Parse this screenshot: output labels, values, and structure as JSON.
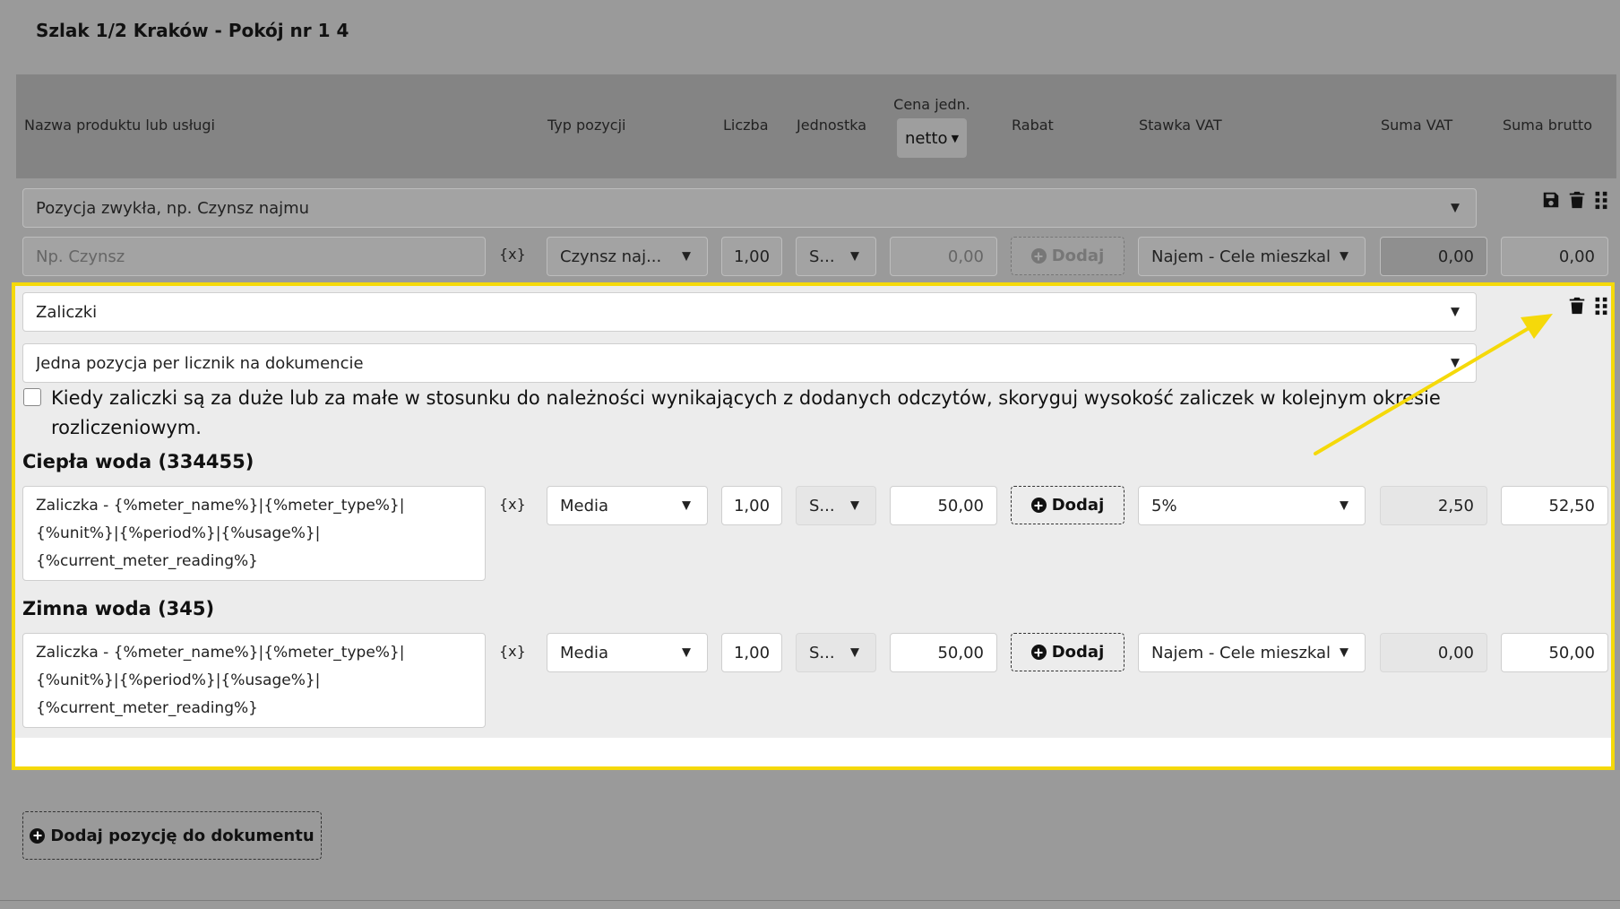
{
  "page": {
    "title": "Szlak 1/2 Kraków - Pokój nr 1 4"
  },
  "header": {
    "col_name": "Nazwa produktu lub usługi",
    "col_type": "Typ pozycji",
    "col_qty": "Liczba",
    "col_unit": "Jednostka",
    "col_price": "Cena jedn.",
    "price_mode": "netto",
    "col_discount": "Rabat",
    "col_vat_rate": "Stawka VAT",
    "col_vat_sum": "Suma VAT",
    "col_gross_sum": "Suma brutto"
  },
  "row1": {
    "position_type": "Pozycja zwykła, np. Czynsz najmu",
    "name_placeholder": "Np. Czynsz",
    "vars": "{x}",
    "type": "Czynsz naj...",
    "qty": "1,00",
    "unit": "S...",
    "price": "0,00",
    "discount": "Dodaj",
    "vat_rate": "Najem - Cele mieszkal",
    "vat_sum": "0,00",
    "gross": "0,00"
  },
  "advances": {
    "position_type": "Zaliczki",
    "mode": "Jedna pozycja per licznik na dokumencie",
    "checkbox_line1": "Kiedy zaliczki są za duże lub za małe w stosunku do należności wynikających z dodanych odczytów, skoryguj wysokość zaliczek w kolejnym okresie",
    "checkbox_line2": "rozliczeniowym.",
    "checkbox_checked": false,
    "meters": [
      {
        "title": "Ciepła woda (334455)",
        "name_lines": [
          "Zaliczka - {%meter_name%}|{%meter_type%}|",
          "{%unit%}|{%period%}|{%usage%}|",
          "{%current_meter_reading%}"
        ],
        "vars": "{x}",
        "type": "Media",
        "qty": "1,00",
        "unit": "S...",
        "price": "50,00",
        "discount": "Dodaj",
        "vat_rate": "5%",
        "vat_sum": "2,50",
        "gross": "52,50"
      },
      {
        "title": "Zimna woda (345)",
        "name_lines": [
          "Zaliczka - {%meter_name%}|{%meter_type%}|",
          "{%unit%}|{%period%}|{%usage%}|",
          "{%current_meter_reading%}"
        ],
        "vars": "{x}",
        "type": "Media",
        "qty": "1,00",
        "unit": "S...",
        "price": "50,00",
        "discount": "Dodaj",
        "vat_rate": "Najem - Cele mieszkal",
        "vat_sum": "0,00",
        "gross": "50,00"
      }
    ]
  },
  "footer": {
    "add_position": "Dodaj pozycję do dokumentu"
  },
  "colors": {
    "highlight": "#f5d90a",
    "arrow": "#f5d90a"
  }
}
